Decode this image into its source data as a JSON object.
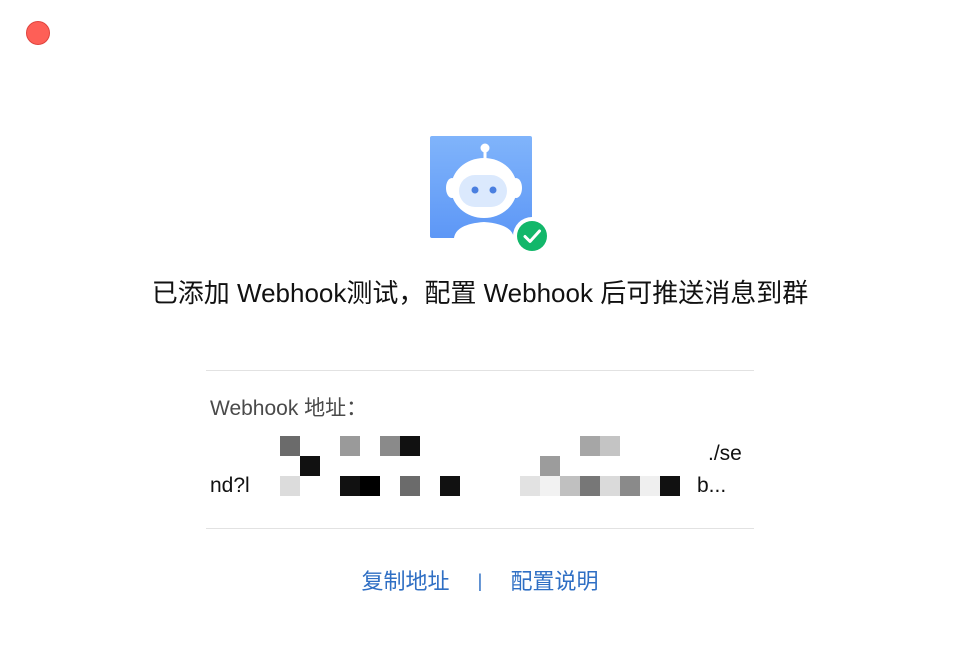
{
  "window": {
    "close_color": "#fe5f57"
  },
  "bot": {
    "icon": "robot-avatar-icon",
    "badge_icon": "check-circle-icon",
    "badge_color": "#12b76a"
  },
  "message": {
    "title": "已添加 Webhook测试，配置 Webhook 后可推送消息到群"
  },
  "webhook": {
    "label": "Webhook 地址：",
    "url_visible_end": "./se",
    "url_visible_start": "nd?l",
    "url_ellipsis": "b..."
  },
  "actions": {
    "copy_label": "复制地址",
    "separator": "|",
    "docs_label": "配置说明",
    "link_color": "#2f6fc4"
  }
}
